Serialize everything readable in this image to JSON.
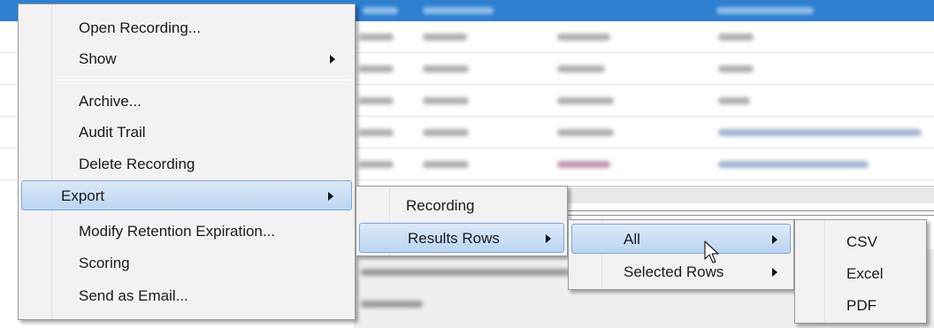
{
  "context_menu": {
    "items": [
      {
        "label": "Open Recording...",
        "submenu": false
      },
      {
        "label": "Show",
        "submenu": true
      },
      {
        "label": "Archive...",
        "submenu": false
      },
      {
        "label": "Audit Trail",
        "submenu": false
      },
      {
        "label": "Delete Recording",
        "submenu": false
      },
      {
        "label": "Export",
        "submenu": true,
        "highlighted": true
      },
      {
        "label": "Modify Retention Expiration...",
        "submenu": false
      },
      {
        "label": "Scoring",
        "submenu": false
      },
      {
        "label": "Send as Email...",
        "submenu": false
      }
    ]
  },
  "export_menu": {
    "items": [
      {
        "label": "Recording",
        "submenu": false
      },
      {
        "label": "Results Rows",
        "submenu": true,
        "highlighted": true
      }
    ]
  },
  "results_rows_menu": {
    "items": [
      {
        "label": "All",
        "submenu": true,
        "highlighted": true
      },
      {
        "label": "Selected Rows",
        "submenu": true
      }
    ]
  },
  "all_menu": {
    "items": [
      {
        "label": "CSV"
      },
      {
        "label": "Excel"
      },
      {
        "label": "PDF"
      }
    ]
  },
  "colors": {
    "highlight": "#c4daf3",
    "menu_bg": "#f2f2f2",
    "header_bg": "#2f7fd0"
  },
  "icons": [
    "submenu-arrow-icon",
    "mouse-pointer-icon"
  ]
}
